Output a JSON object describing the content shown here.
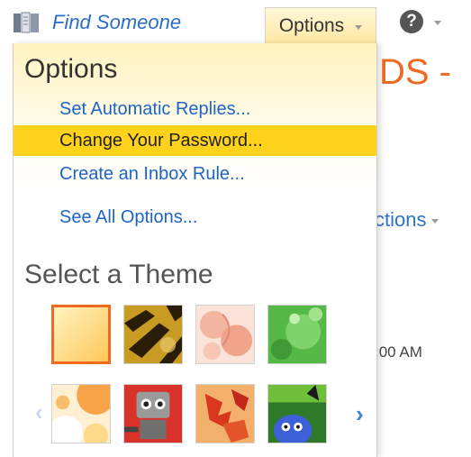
{
  "topbar": {
    "find_someone_label": "Find Someone",
    "options_label": "Options"
  },
  "background": {
    "heading_fragment": "DS -",
    "actions_fragment": "ctions",
    "time_fragment": ":00 AM"
  },
  "options_menu": {
    "title": "Options",
    "items": [
      {
        "label": "Set Automatic Replies...",
        "highlighted": false
      },
      {
        "label": "Change Your Password...",
        "highlighted": true
      },
      {
        "label": "Create an Inbox Rule...",
        "highlighted": false
      },
      {
        "label": "See All Options...",
        "highlighted": false
      }
    ]
  },
  "themes": {
    "title": "Select a Theme",
    "items": [
      {
        "icon": "theme-sunshine",
        "selected": true
      },
      {
        "icon": "theme-tiger-stripes",
        "selected": false
      },
      {
        "icon": "theme-peach-flowers",
        "selected": false
      },
      {
        "icon": "theme-green-leaves",
        "selected": false
      },
      {
        "icon": "theme-orange-circles",
        "selected": false
      },
      {
        "icon": "theme-robot",
        "selected": false
      },
      {
        "icon": "theme-autumn-leaves",
        "selected": false
      },
      {
        "icon": "theme-blue-cat",
        "selected": false
      }
    ]
  },
  "colors": {
    "link": "#1e64c6",
    "highlight": "#ffd21b",
    "accent_orange": "#ef6a1e"
  }
}
